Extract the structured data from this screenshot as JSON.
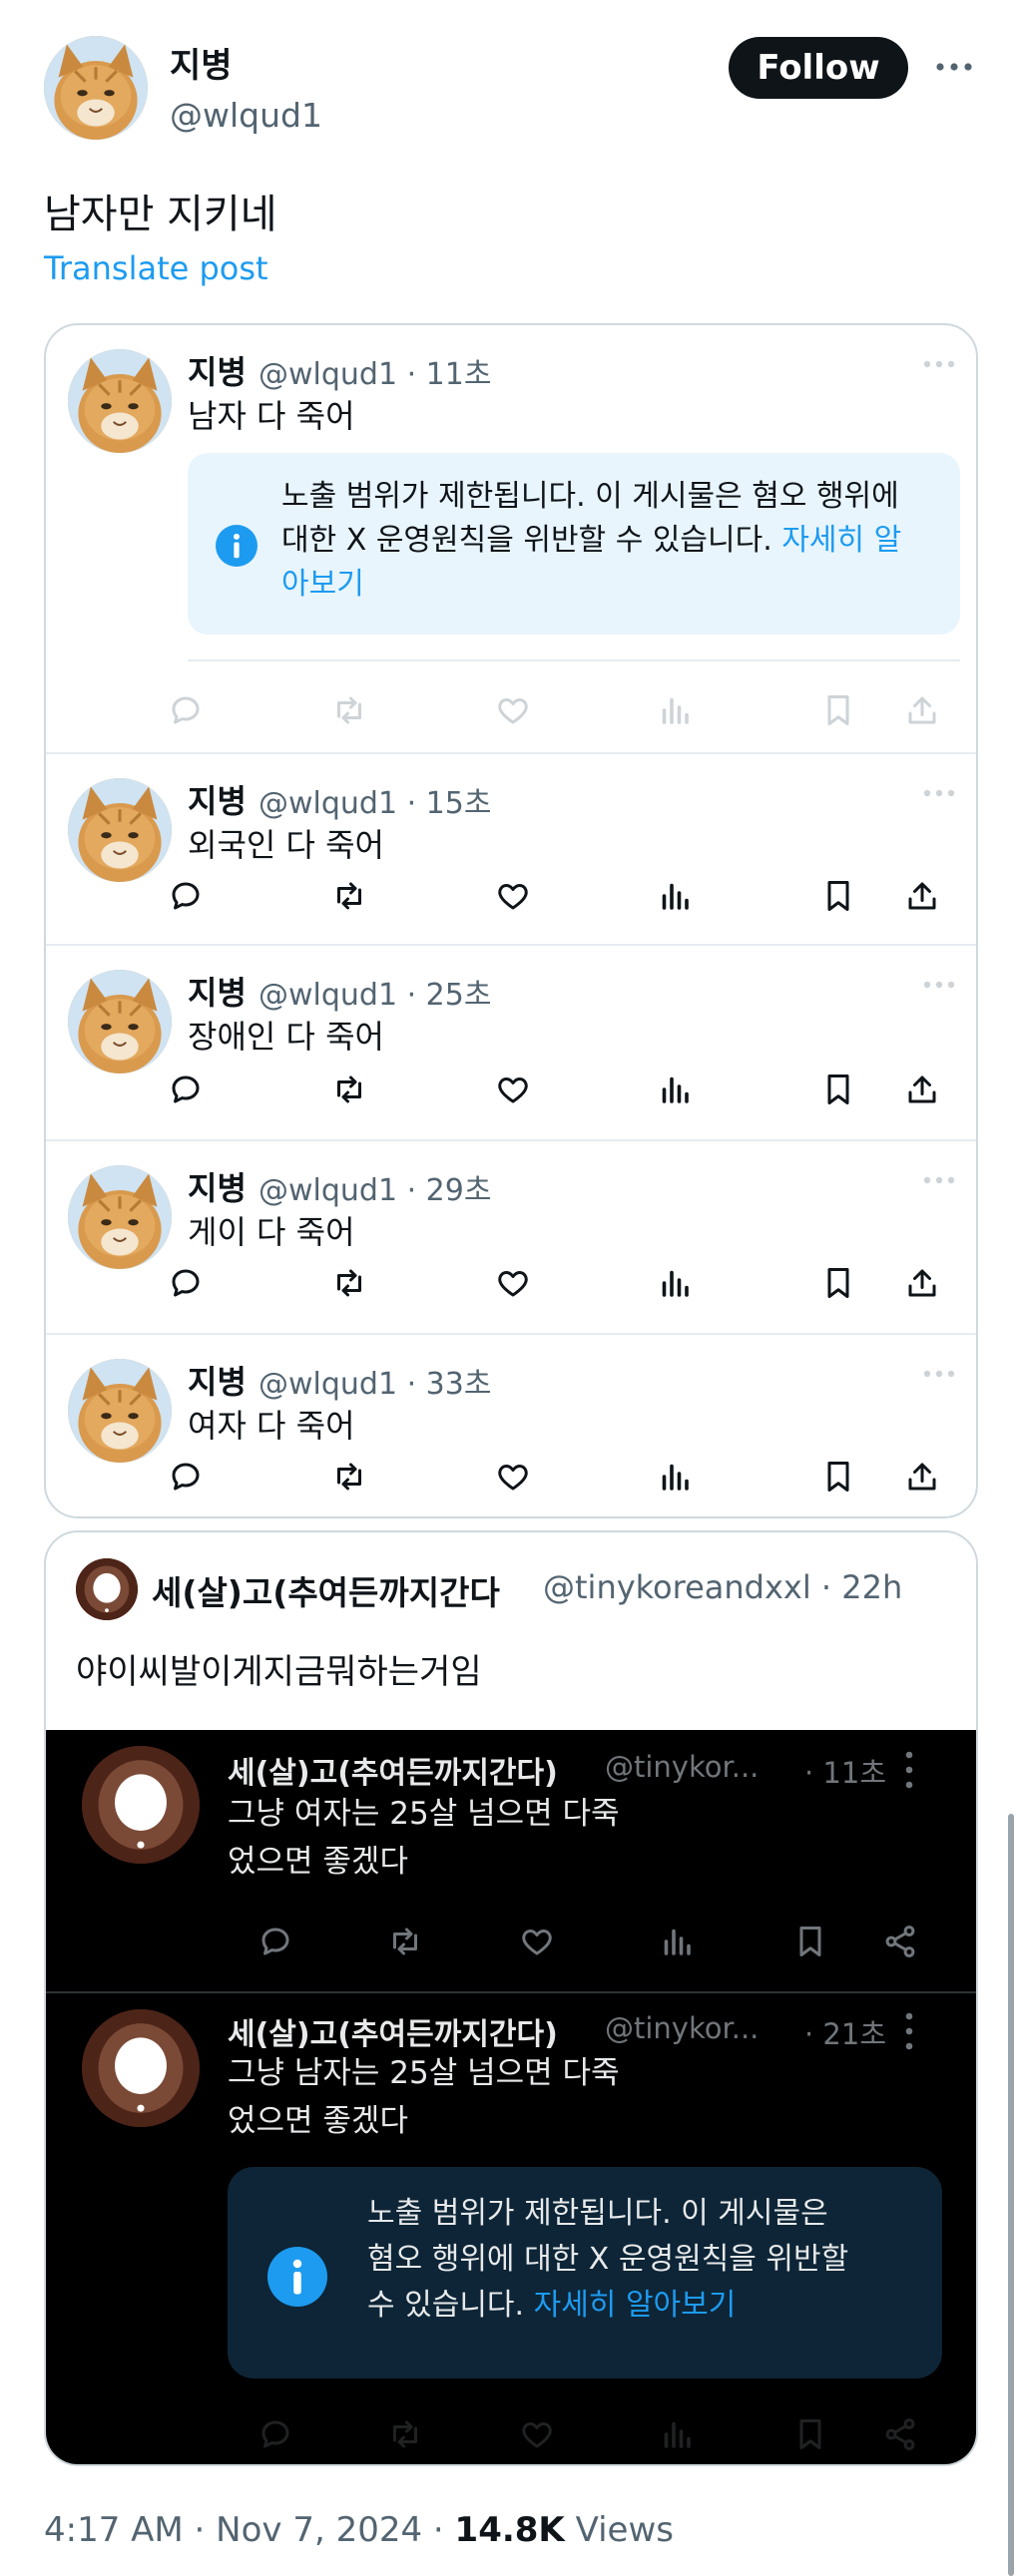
{
  "author": {
    "name": "지병",
    "handle": "@wlqud1"
  },
  "follow_label": "Follow",
  "post_text": "남자만 지키네",
  "translate_label": "Translate post",
  "thread": [
    {
      "name": "지병",
      "meta": "@wlqud1 · 11초",
      "text": "남자 다 죽어",
      "restricted": true
    },
    {
      "name": "지병",
      "meta": "@wlqud1 · 15초",
      "text": "외국인 다 죽어",
      "restricted": false
    },
    {
      "name": "지병",
      "meta": "@wlqud1 · 25초",
      "text": "장애인 다 죽어",
      "restricted": false
    },
    {
      "name": "지병",
      "meta": "@wlqud1 · 29초",
      "text": "게이 다 죽어",
      "restricted": false
    },
    {
      "name": "지병",
      "meta": "@wlqud1 · 33초",
      "text": "여자 다 죽어",
      "restricted": false
    }
  ],
  "notice": {
    "text": "노출 범위가 제한됩니다. 이 게시물은 혐오 행위에 대한 X 운영원칙을 위반할 수 있습니다. ",
    "link": "자세히 알아보기"
  },
  "quote": {
    "name": "세(살)고(추여든까지간다",
    "meta": "@tinykoreandxxl · 22h",
    "text": "야이씨발이게지금뭐하는거임",
    "replies": [
      {
        "name": "세(살)고(추여든까지간다)",
        "handle": "@tinykor...",
        "time": "· 11초",
        "line1": "그냥 여자는 25살 넘으면 다죽",
        "line2": "었으면 좋겠다"
      },
      {
        "name": "세(살)고(추여든까지간다)",
        "handle": "@tinykor...",
        "time": "· 21초",
        "line1": "그냥 남자는 25살 넘으면 다죽",
        "line2": "었으면 좋겠다"
      }
    ],
    "notice_line1": "노출 범위가 제한됩니다. 이 게시물은",
    "notice_line2": "혐오 행위에 대한 X 운영원칙을 위반할",
    "notice_line3": "수 있습니다. ",
    "notice_link": "자세히 알아보기"
  },
  "footer": {
    "time": "4:17 AM · Nov 7, 2024 · ",
    "views_count": "14.8K",
    "views_label": " Views"
  }
}
